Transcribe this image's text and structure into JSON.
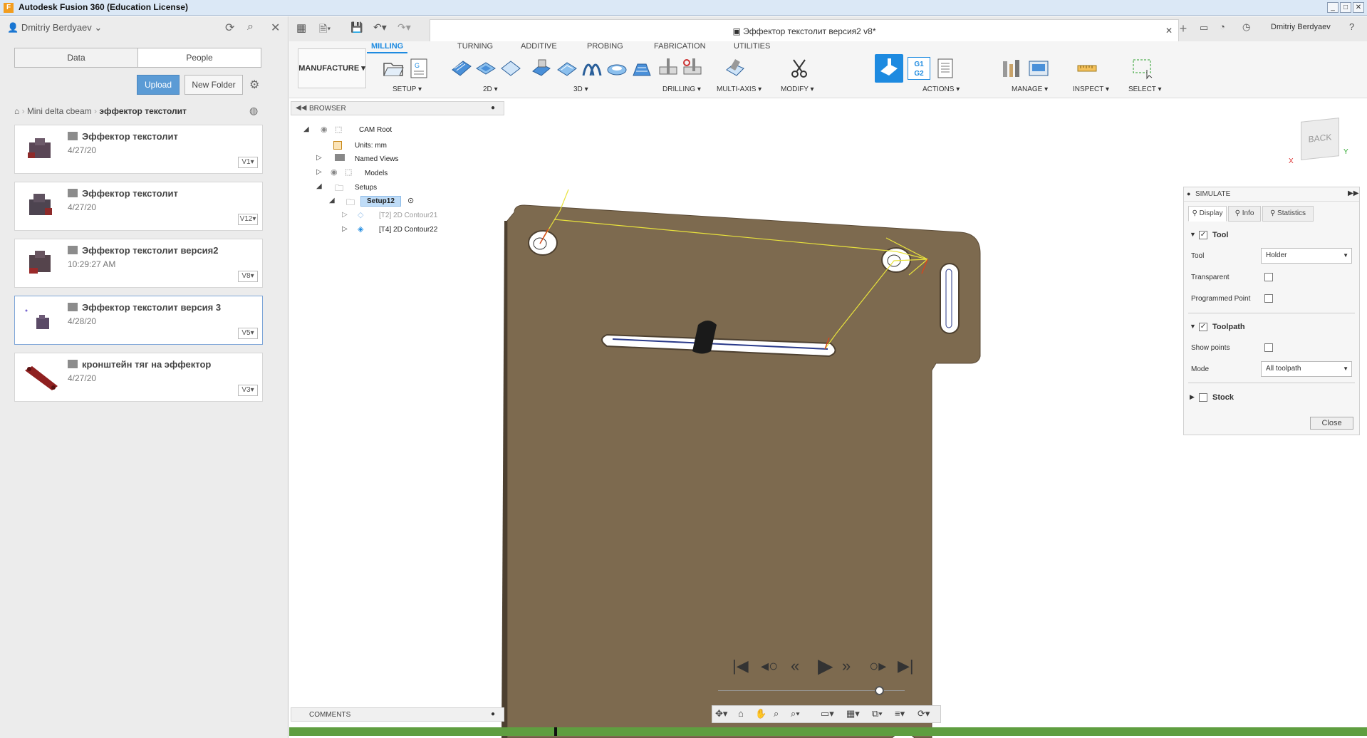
{
  "window": {
    "title": "Autodesk Fusion 360 (Education License)",
    "app_icon_letter": "F"
  },
  "data_panel": {
    "user_name": "Dmitriy Berdyaev",
    "tabs": [
      "Data",
      "People"
    ],
    "upload_label": "Upload",
    "new_folder_label": "New Folder",
    "breadcrumb": [
      "Mini delta cbeam",
      "эффектор текстолит"
    ],
    "files": [
      {
        "name": "Эффектор текстолит",
        "date": "4/27/20",
        "version": "V1"
      },
      {
        "name": "Эффектор текстолит",
        "date": "4/27/20",
        "version": "V12"
      },
      {
        "name": "Эффектор текстолит версия2",
        "date": "10:29:27 AM",
        "version": "V8"
      },
      {
        "name": "Эффектор текстолит версия 3",
        "date": "4/28/20",
        "version": "V5"
      },
      {
        "name": "кронштейн тяг на эффектор",
        "date": "4/27/20",
        "version": "V3"
      }
    ]
  },
  "header": {
    "doc_title": "Эффектор текстолит версия2 v8*",
    "user_name": "Dmitriy Berdyaev"
  },
  "ribbon": {
    "workspace": "MANUFACTURE",
    "tabs": [
      "MILLING",
      "TURNING",
      "ADDITIVE",
      "PROBING",
      "FABRICATION",
      "UTILITIES"
    ],
    "groups": [
      "SETUP",
      "2D",
      "3D",
      "DRILLING",
      "MULTI-AXIS",
      "MODIFY",
      "ACTIONS",
      "MANAGE",
      "INSPECT",
      "SELECT"
    ],
    "g1g2_label_1": "G1",
    "g1g2_label_2": "G2"
  },
  "browser": {
    "title": "BROWSER",
    "cam_root": "CAM Root",
    "units": "Units: mm",
    "named_views": "Named Views",
    "models": "Models",
    "setups": "Setups",
    "setup12": "Setup12",
    "op1": "[T2] 2D Contour21",
    "op2": "[T4] 2D Contour22"
  },
  "viewcube": {
    "label": "BACK",
    "x_axis": "X",
    "y_axis": "Y"
  },
  "simulate": {
    "title": "SIMULATE",
    "tabs": [
      "Display",
      "Info",
      "Statistics"
    ],
    "tool_section": "Tool",
    "tool_label": "Tool",
    "tool_value": "Holder",
    "transparent_label": "Transparent",
    "programmed_point_label": "Programmed Point",
    "toolpath_section": "Toolpath",
    "show_points_label": "Show points",
    "mode_label": "Mode",
    "mode_value": "All toolpath",
    "stock_section": "Stock",
    "close_label": "Close"
  },
  "comments": {
    "title": "COMMENTS"
  },
  "colors": {
    "accent": "#1d8ae0",
    "board": "#7d6a4f",
    "toolpath": "#e8e23c",
    "timeline": "#5f9e40"
  }
}
